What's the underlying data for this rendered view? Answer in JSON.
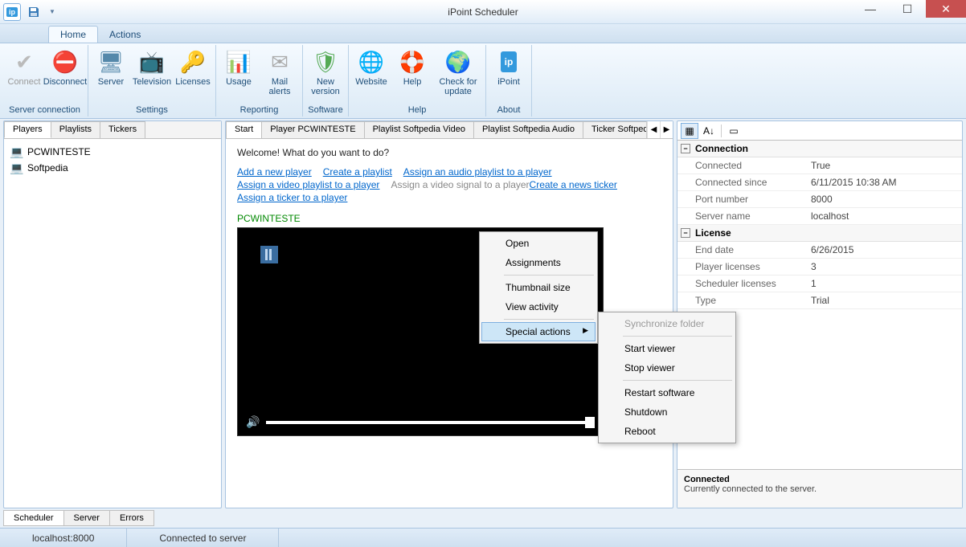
{
  "title": "iPoint Scheduler",
  "ribbon_tabs": [
    "Home",
    "Actions"
  ],
  "ribbon": {
    "groups": [
      {
        "label": "Server connection",
        "items": [
          {
            "name": "connect",
            "label": "Connect",
            "icon": "✔",
            "disabled": true
          },
          {
            "name": "disconnect",
            "label": "Disconnect",
            "icon": "⛔"
          }
        ]
      },
      {
        "label": "Settings",
        "items": [
          {
            "name": "server",
            "label": "Server",
            "icon": "🖥"
          },
          {
            "name": "television",
            "label": "Television",
            "icon": "📺"
          },
          {
            "name": "licenses",
            "label": "Licenses",
            "icon": "🔑"
          }
        ]
      },
      {
        "label": "Reporting",
        "items": [
          {
            "name": "usage",
            "label": "Usage",
            "icon": "📊"
          },
          {
            "name": "mail-alerts",
            "label": "Mail alerts",
            "icon": "✉"
          }
        ]
      },
      {
        "label": "Software",
        "items": [
          {
            "name": "new-version",
            "label": "New version",
            "icon": "🛡"
          }
        ]
      },
      {
        "label": "Help",
        "items": [
          {
            "name": "website",
            "label": "Website",
            "icon": "🌐"
          },
          {
            "name": "help",
            "label": "Help",
            "icon": "🛟"
          },
          {
            "name": "check-update",
            "label": "Check for update",
            "icon": "🌍",
            "wide": true
          }
        ]
      },
      {
        "label": "About",
        "items": [
          {
            "name": "ipoint",
            "label": "iPoint",
            "icon": "ip"
          }
        ]
      }
    ]
  },
  "left_tabs": [
    "Players",
    "Playlists",
    "Tickers"
  ],
  "tree_items": [
    {
      "label": "PCWINTESTE",
      "icon": "💻"
    },
    {
      "label": "Softpedia",
      "icon": "💻"
    }
  ],
  "center_tabs": [
    "Start",
    "Player PCWINTESTE",
    "Playlist Softpedia Video",
    "Playlist Softpedia Audio",
    "Ticker Softpedia"
  ],
  "welcome": "Welcome! What do you want to do?",
  "link_rows": [
    [
      {
        "text": "Add a new player",
        "enabled": true
      },
      {
        "text": "Create a playlist",
        "enabled": true
      },
      {
        "text": "Assign an audio playlist to a player",
        "enabled": true
      }
    ],
    [
      {
        "text": "Assign a video playlist to a player",
        "enabled": true
      },
      {
        "text": "Assign a video signal to a player",
        "enabled": false
      },
      {
        "text": "Create a news ticker",
        "enabled": true
      }
    ],
    [
      {
        "text": "Assign a ticker to a player",
        "enabled": true
      }
    ]
  ],
  "player_name": "PCWINTESTE",
  "ctx1": [
    "Open",
    "Assignments",
    "---",
    "Thumbnail size",
    "View activity",
    "---",
    "Special actions"
  ],
  "ctx1_submenu": [
    2,
    6
  ],
  "ctx1_highlight": 6,
  "ctx2": [
    "Synchronize folder",
    "---",
    "Start viewer",
    "Stop viewer",
    "---",
    "Restart software",
    "Shutdown",
    "Reboot"
  ],
  "ctx2_disabled": [
    0
  ],
  "prop_sections": [
    {
      "title": "Connection",
      "rows": [
        {
          "k": "Connected",
          "v": "True"
        },
        {
          "k": "Connected since",
          "v": "6/11/2015 10:38 AM"
        },
        {
          "k": "Port number",
          "v": "8000"
        },
        {
          "k": "Server name",
          "v": "localhost"
        }
      ]
    },
    {
      "title": "License",
      "rows": [
        {
          "k": "End date",
          "v": "6/26/2015"
        },
        {
          "k": "Player licenses",
          "v": "3"
        },
        {
          "k": "Scheduler licenses",
          "v": "1"
        },
        {
          "k": "Type",
          "v": "Trial"
        }
      ]
    }
  ],
  "right_desc": {
    "title": "Connected",
    "text": "Currently connected to the server."
  },
  "bottom_tabs": [
    "Scheduler",
    "Server",
    "Errors"
  ],
  "status": {
    "host": "localhost:8000",
    "msg": "Connected to server"
  }
}
